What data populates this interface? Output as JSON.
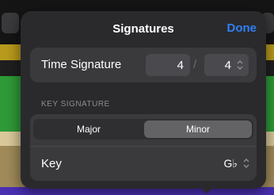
{
  "popover": {
    "title": "Signatures",
    "done_label": "Done"
  },
  "time_signature": {
    "label": "Time Signature",
    "numerator": "4",
    "separator": "/",
    "denominator": "4"
  },
  "key_signature": {
    "section_label": "KEY SIGNATURE",
    "modes": [
      "Major",
      "Minor"
    ],
    "selected_mode": "Minor",
    "key_label": "Key",
    "key_value": "G♭"
  },
  "colors": {
    "accent": "#2f7ff6",
    "popover_bg": "#2a2a2d",
    "card_bg": "#3a3a3d",
    "selected_segment": "#636366"
  },
  "icons": {
    "stepper": "chevron-up-down-icon"
  }
}
